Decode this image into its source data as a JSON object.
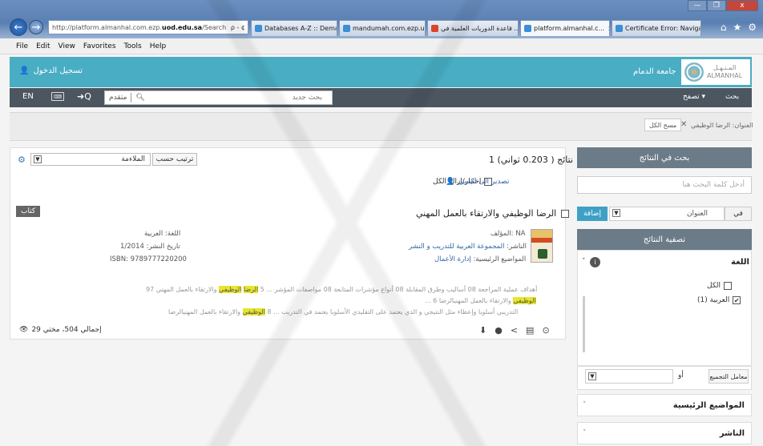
{
  "browser": {
    "url_prefix": "http://platform.almanhal.com.ezp.",
    "url_domain": "uod.edu.sa",
    "url_suffix": "/Search",
    "url_controls": "ρ - ¢",
    "tabs": [
      {
        "label": "Databases A-Z :: Dema..."
      },
      {
        "label": "mandumah.com.ezp.u..."
      },
      {
        "label": "قاعدة الدوريات العلمية في ..."
      },
      {
        "label": "platform.almanhal.c..."
      },
      {
        "label": "Certificate Error: Naviga..."
      }
    ],
    "tab_close": "×",
    "window_controls": {
      "minimize": "—",
      "restore": "❐",
      "close": "x"
    },
    "tool_icons": {
      "home": "⌂",
      "favorites": "★",
      "settings": "⚙"
    },
    "menu": [
      "File",
      "Edit",
      "View",
      "Favorites",
      "Tools",
      "Help"
    ]
  },
  "header": {
    "login": "تسجيل الدخول",
    "university": "جامعة الدمام",
    "logo_arabic": "المـنـهـل",
    "logo_latin": "ALMANHAL",
    "lang_toggle": "EN",
    "adv_search": "متقدم",
    "search_placeholder": "بحث جديد",
    "nav_browse": "تصفح ▾",
    "nav_search": "بحث",
    "adv_icon": "➜Q",
    "kbd_icon": "⌨"
  },
  "filters": {
    "title_label": "العنوان: الرضا الوظيفي",
    "remove": "✕",
    "clear_all": "مسح الكل"
  },
  "results": {
    "count": "1 نتائج ( 0.203 ثواني)",
    "sort_label": "ترتيب حسب",
    "sort_value": "الملاءمة",
    "select_all": "اختيار/إزالة الكل",
    "export": "تصدير الى اكسيل",
    "item": {
      "title": "الرضا الوظيفي والارتقاء بالعمل المهني",
      "type": "كتاب",
      "author_label": "المؤلف:",
      "author": "NA",
      "publisher_label": "الناشر:",
      "publisher": "المجموعة العربية للتدريب و النشر",
      "subjects_label": "المواضيع الرئيسية:",
      "subjects": "إدارة الأعمال",
      "language": "اللغة: العربية",
      "date": "تاريخ النشر: 1/2014",
      "isbn": "ISBN: 9789777220200",
      "snippets": [
        {
          "pre": "أهداف عملية المراجعة 08 أساليب وطرق المقابلة 08 أنواع مؤشرات المتابعة 08 مواصفات المؤشر ...   5   ",
          "hl1": "الرضا",
          "mid": " ",
          "hl2": "الوظيفي",
          "post": " والارتقاء بالعمل المهني 97"
        },
        {
          "pre": "...   6   ",
          "hl1": "الوظيفي",
          "mid": "",
          "hl2": "",
          "post": " والارتقاء بالعمل المهنيالرضا"
        },
        {
          "pre": "التدريبي أسلوبا وإعطاء مثل النتيجي و الذي يعتمد على التقليدي الأسلوبا يعتمد في التدريب ...   8   ",
          "hl1": "الوظيفي",
          "mid": "",
          "hl2": "",
          "post": " والارتقاء بالعمل المهنيالرضا"
        }
      ]
    },
    "footer": "إجمالي 504، مختي 29",
    "footer_icon": "👁",
    "action_icons": [
      "⬇",
      "●",
      "<",
      "▤",
      "⊙"
    ]
  },
  "sidebar": {
    "search_head": "بحث في النتائج",
    "search_placeholder": "أدخل كلمة البحث هنا",
    "in_label": "في",
    "field_value": "العنوان",
    "add": "إضافة",
    "refine_head": "تصفية النتائج",
    "language_title": "اللغة",
    "language_info": "i",
    "chev": "˅",
    "language_options": [
      {
        "label": "الكل",
        "checked": false
      },
      {
        "label": "العربية (1)",
        "checked": true
      }
    ],
    "combine_label": "معامل التجميع",
    "combine_op": "أو",
    "facets": [
      {
        "title": "المواضيع الرئيسية"
      },
      {
        "title": "الناشر"
      }
    ]
  }
}
